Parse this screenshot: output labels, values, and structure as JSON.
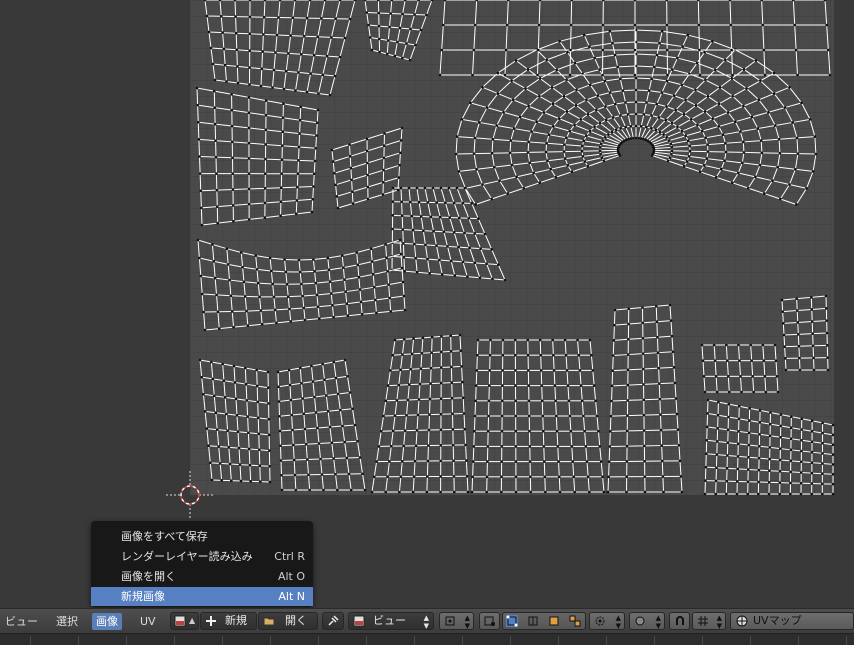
{
  "image_menu": {
    "items": [
      {
        "label": "画像をすべて保存",
        "shortcut": ""
      },
      {
        "label": "レンダーレイヤー読み込み",
        "shortcut": "Ctrl R"
      },
      {
        "label": "画像を開く",
        "shortcut": "Alt O"
      },
      {
        "label": "新規画像",
        "shortcut": "Alt N"
      }
    ],
    "highlighted_index": 3
  },
  "header": {
    "menus": {
      "view": "ビュー",
      "select": "選択",
      "image": "画像",
      "uv": "UV"
    },
    "active_menu": "画像",
    "new_label": "新規",
    "open_label": "開く",
    "mode_label": "ビュー",
    "uv_map_label": "UVマップ"
  },
  "icons": [
    "image-browse-icon",
    "add-icon",
    "folder-open-icon",
    "pin-icon",
    "image-mode-icon",
    "pivot-icon",
    "sticky-select-icon",
    "uv-select-vertex-icon",
    "uv-select-edge-icon",
    "uv-select-face-icon",
    "uv-select-island-icon",
    "proportional-icon",
    "falloff-icon",
    "snap-icon",
    "snap-target-icon",
    "uv-map-icon",
    "cursor-3d-icon"
  ],
  "colors": {
    "accent": "#5680c2",
    "viewport_bg": "#393939",
    "uv_area_bg": "#4a4a4a",
    "wire": "#ffffff"
  }
}
